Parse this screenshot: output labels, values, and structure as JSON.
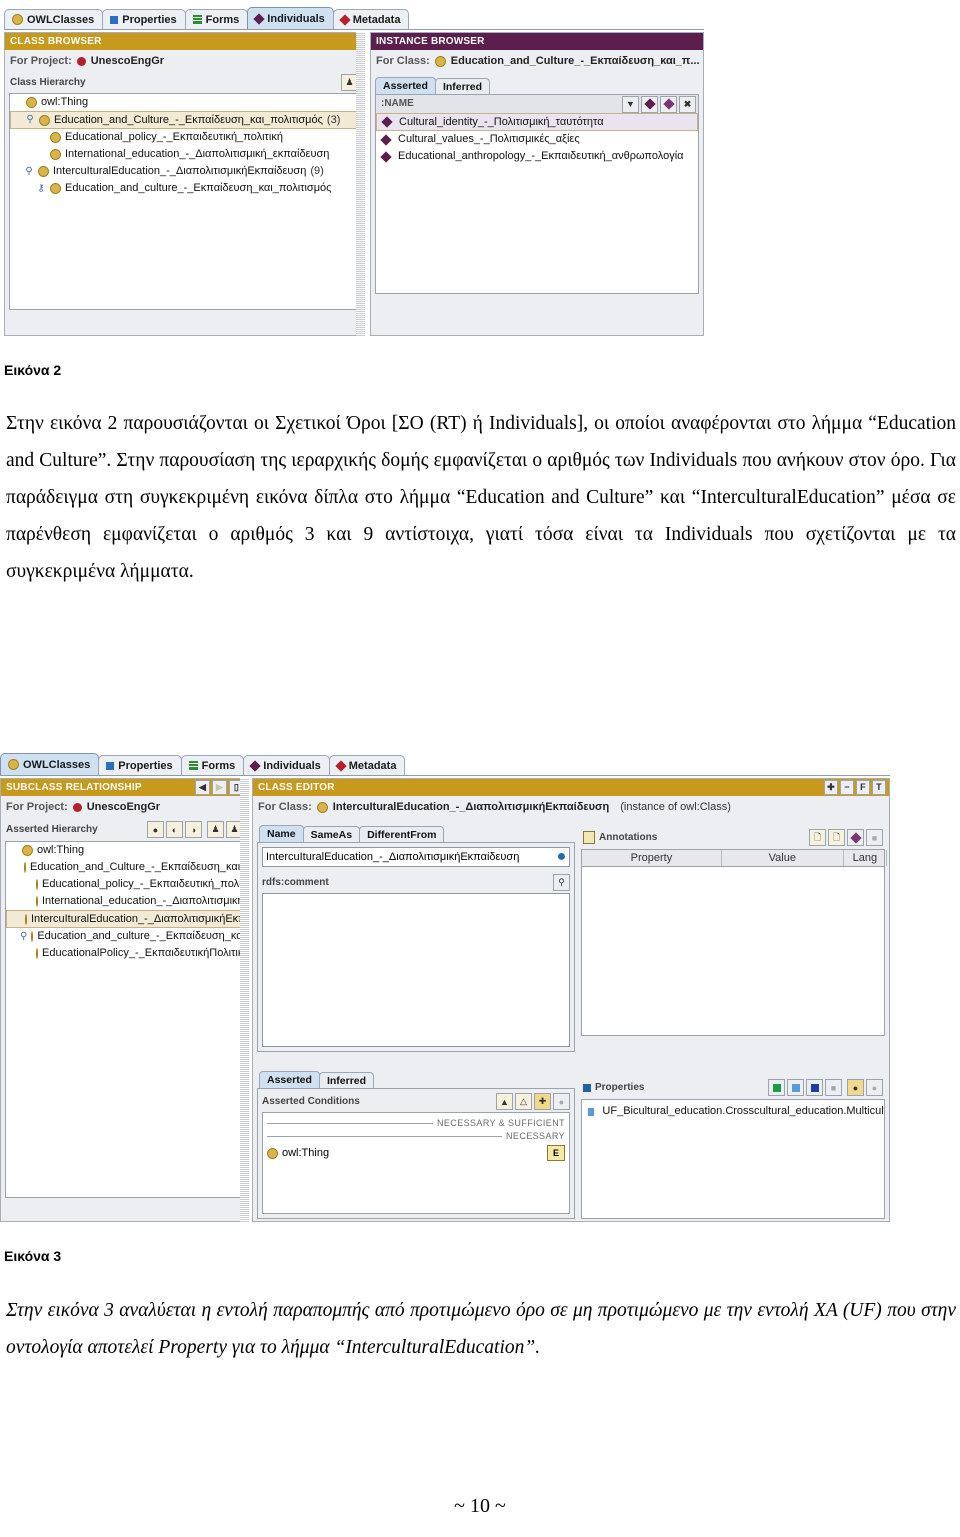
{
  "figure2": {
    "tabs": [
      {
        "label": "OWLClasses",
        "icon": "circle-gold-icon",
        "active": false
      },
      {
        "label": "Properties",
        "icon": "square-blue-icon",
        "active": false
      },
      {
        "label": "Forms",
        "icon": "bars-green-icon",
        "active": false
      },
      {
        "label": "Individuals",
        "icon": "diamond-purple-icon",
        "active": true
      },
      {
        "label": "Metadata",
        "icon": "diamond-red-icon",
        "active": false
      }
    ],
    "class_browser": {
      "title": "CLASS BROWSER",
      "for_project_label": "For Project:",
      "project": "UnescoEngGr",
      "hierarchy_label": "Class Hierarchy",
      "nodes": [
        {
          "label": "owl:Thing",
          "indent": 0,
          "count": "",
          "expander": "",
          "selected": false
        },
        {
          "label": "Education_and_Culture_-_Εκπαίδευση_και_πολιτισμός",
          "indent": 1,
          "count": "(3)",
          "expander": "expanded",
          "selected": true
        },
        {
          "label": "Educational_policy_-_Εκπαιδευτική_πολιτική",
          "indent": 2,
          "count": "",
          "expander": "",
          "selected": false
        },
        {
          "label": "International_education_-_Διαπολιτισμική_εκπαίδευση",
          "indent": 2,
          "count": "",
          "expander": "",
          "selected": false
        },
        {
          "label": "IntercuIturalEducation_-_ΔιαπολιτισμικήΕκπαίδευση",
          "indent": 1,
          "count": "(9)",
          "expander": "expanded",
          "selected": false
        },
        {
          "label": "Education_and_culture_-_Εκπαίδευση_και_πολιτισμός",
          "indent": 2,
          "count": "",
          "expander": "collapsed",
          "selected": false
        }
      ]
    },
    "instance_browser": {
      "title": "INSTANCE BROWSER",
      "for_class_label": "For Class:",
      "for_class": "Education_and_Culture_-_Εκπαίδευση_και_π...",
      "subtabs": [
        {
          "label": "Asserted",
          "active": true
        },
        {
          "label": "Inferred",
          "active": false
        }
      ],
      "name_col": ":NAME",
      "buttons": [
        "chevron-down-icon",
        "add-instance-icon",
        "diamond-icon",
        "delete-icon"
      ],
      "instances": [
        {
          "label": "Cultural_identity_-_Πολιτισμική_ταυτότητα",
          "selected": true
        },
        {
          "label": "Cultural_values_-_Πολιτισμικές_αξίες",
          "selected": false
        },
        {
          "label": "Educational_anthropology_-_Εκπαιδευτική_ανθρωπολογία",
          "selected": false
        }
      ]
    }
  },
  "caption2": "Εικόνα 2",
  "paragraph2": "Στην εικόνα 2 παρουσιάζονται οι Σχετικοί Όροι [ΣΟ (RT) ή Individuals], οι οποίοι αναφέρονται στο λήμμα “Education and Culture”. Στην παρουσίαση της ιεραρχικής δομής εμφανίζεται ο αριθμός των Individuals που ανήκουν στον όρο. Για παράδειγμα στη συγκεκριμένη εικόνα δίπλα στο λήμμα “Education and Culture” και “InterculturalEducation” μέσα σε παρένθεση εμφανίζεται ο αριθμός 3 και 9 αντίστοιχα, γιατί τόσα είναι τα Individuals που σχετίζονται με τα συγκεκριμένα λήμματα.",
  "figure3": {
    "tabs": [
      {
        "label": "OWLClasses",
        "icon": "circle-gold-icon",
        "active": true
      },
      {
        "label": "Properties",
        "icon": "square-blue-icon",
        "active": false
      },
      {
        "label": "Forms",
        "icon": "bars-green-icon",
        "active": false
      },
      {
        "label": "Individuals",
        "icon": "diamond-purple-icon",
        "active": false
      },
      {
        "label": "Metadata",
        "icon": "diamond-red-icon",
        "active": false
      }
    ],
    "subclass_panel": {
      "title": "SUBCLASS RELATIONSHIP",
      "header_buttons": [
        "back-arrow-icon",
        "forward-arrow-icon",
        "copy-icon"
      ],
      "for_project_label": "For Project:",
      "project": "UnescoEngGr",
      "hierarchy_label": "Asserted Hierarchy",
      "toolbar_buttons": [
        "create-class-icon",
        "create-subclass-icon",
        "delete-class-icon",
        "search-1-icon",
        "search-c-icon"
      ],
      "nodes": [
        {
          "label": "owl:Thing",
          "indent": 0,
          "expander": "",
          "selected": false
        },
        {
          "label": "Education_and_Culture_-_Εκπαίδευση_και_πολιτισμός",
          "indent": 1,
          "expander": "",
          "selected": false
        },
        {
          "label": "Educational_policy_-_Εκπαιδευτική_πολιτική",
          "indent": 2,
          "expander": "",
          "selected": false
        },
        {
          "label": "International_education_-_Διαπολιτισμική_εκπαίδευση",
          "indent": 2,
          "expander": "",
          "selected": false
        },
        {
          "label": "IntercuIturalEducation_-_ΔιαπολιτισμικήΕκπαίδευση",
          "indent": 1,
          "expander": "",
          "selected": true
        },
        {
          "label": "Education_and_culture_-_Εκπαίδευση_και_πολιτισμός",
          "indent": 1,
          "expander": "expanded",
          "selected": false
        },
        {
          "label": "EducationalPolicy_-_ΕκπαιδευτικήΠολιτική",
          "indent": 2,
          "expander": "",
          "selected": false
        }
      ]
    },
    "class_editor": {
      "title": "CLASS EDITOR",
      "header_buttons": [
        "plus-icon",
        "minus-icon",
        "f-icon",
        "t-icon"
      ],
      "for_class_label": "For Class:",
      "for_class": "IntercuIturalEducation_-_ΔιαπολιτισμικήΕκπαίδευση",
      "instance_of": "(instance of owl:Class)",
      "tabs": [
        {
          "label": "Name",
          "active": true
        },
        {
          "label": "SameAs",
          "active": false
        },
        {
          "label": "DifferentFrom",
          "active": false
        }
      ],
      "name_value": "IntercuIturalEducation_-_ΔιαπολιτισμικήΕκπαίδευση",
      "comment_label": "rdfs:comment",
      "comment_value": ""
    },
    "annotations": {
      "title": "Annotations",
      "buttons": [
        "new-annotation-icon",
        "new-annotation-lang-icon",
        "diamond-icon",
        "delete-icon"
      ],
      "columns": [
        "Property",
        "Value",
        "Lang"
      ],
      "rows": []
    },
    "conditions": {
      "tabs": [
        {
          "label": "Asserted",
          "active": true
        },
        {
          "label": "Inferred",
          "active": false
        }
      ],
      "title": "Asserted Conditions",
      "buttons": [
        "create-restriction-icon",
        "create-named-class-icon",
        "add-superclass-icon",
        "delete-icon"
      ],
      "group_necessary_sufficient": "NECESSARY & SUFFICIENT",
      "group_necessary": "NECESSARY",
      "items": [
        {
          "label": "owl:Thing",
          "badge": "E"
        }
      ]
    },
    "properties": {
      "title": "Properties",
      "buttons": [
        "new-datatype-prop-icon",
        "new-object-prop-icon",
        "add-prop-icon",
        "remove-prop-icon",
        "view-prop-icon",
        "delete-prop-icon"
      ],
      "rows": [
        {
          "label": "UF_Bicultural_education.Crosscultural_education.Multicultural_educatio"
        }
      ]
    }
  },
  "caption3": "Εικόνα 3",
  "paragraph3": "Στην εικόνα 3 αναλύεται η εντολή παραπομπής από προτιμώμενο όρο σε μη προτιμώμενο με την εντολή ΧΑ (UF) που στην οντολογία αποτελεί Property για το λήμμα “InterculturalEducation”.",
  "page_number": "~ 10 ~"
}
